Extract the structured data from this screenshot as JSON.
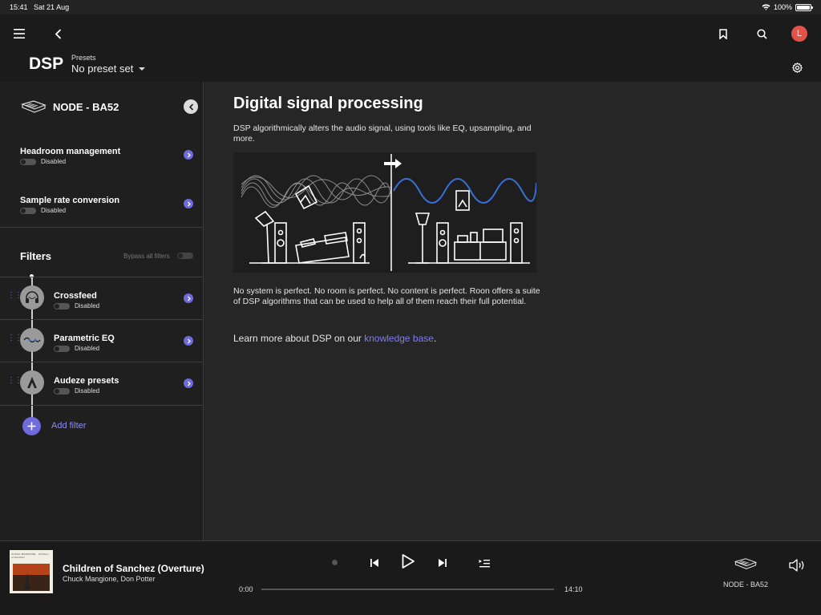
{
  "status_bar": {
    "time": "15:41",
    "date": "Sat 21 Aug",
    "battery": "100%"
  },
  "header": {
    "title": "DSP",
    "presets_label": "Presets",
    "presets_value": "No preset set",
    "avatar_initial": "L"
  },
  "sidebar": {
    "device_name": "NODE - BA52",
    "settings": [
      {
        "label": "Headroom management",
        "state": "Disabled"
      },
      {
        "label": "Sample rate conversion",
        "state": "Disabled"
      }
    ],
    "filters_title": "Filters",
    "bypass_label": "Bypass all filters",
    "filters": [
      {
        "label": "Crossfeed",
        "state": "Disabled"
      },
      {
        "label": "Parametric EQ",
        "state": "Disabled"
      },
      {
        "label": "Audeze presets",
        "state": "Disabled"
      }
    ],
    "add_filter_label": "Add filter"
  },
  "main": {
    "title": "Digital signal processing",
    "intro": "DSP algorithmically alters the audio signal, using tools like EQ, upsampling, and more.",
    "body": "No system is perfect. No room is perfect. No content is perfect. Roon offers a suite of DSP algorithms that can be used to help all of them reach their full potential.",
    "learn_prefix": "Learn more about DSP on our ",
    "learn_link": "knowledge base",
    "learn_suffix": "."
  },
  "player": {
    "track_title": "Children of Sanchez (Overture)",
    "artist": "Chuck Mangione, Don Potter",
    "elapsed": "0:00",
    "duration": "14:10",
    "progress": 0,
    "zone_name": "NODE - BA52",
    "album_cover_text": "CHUCK MANGIONE · Children of Sanchez"
  },
  "colors": {
    "accent": "#6f6bdc",
    "avatar": "#e0524a",
    "link": "#7f7cf0",
    "wave_after": "#3a6fd8"
  }
}
